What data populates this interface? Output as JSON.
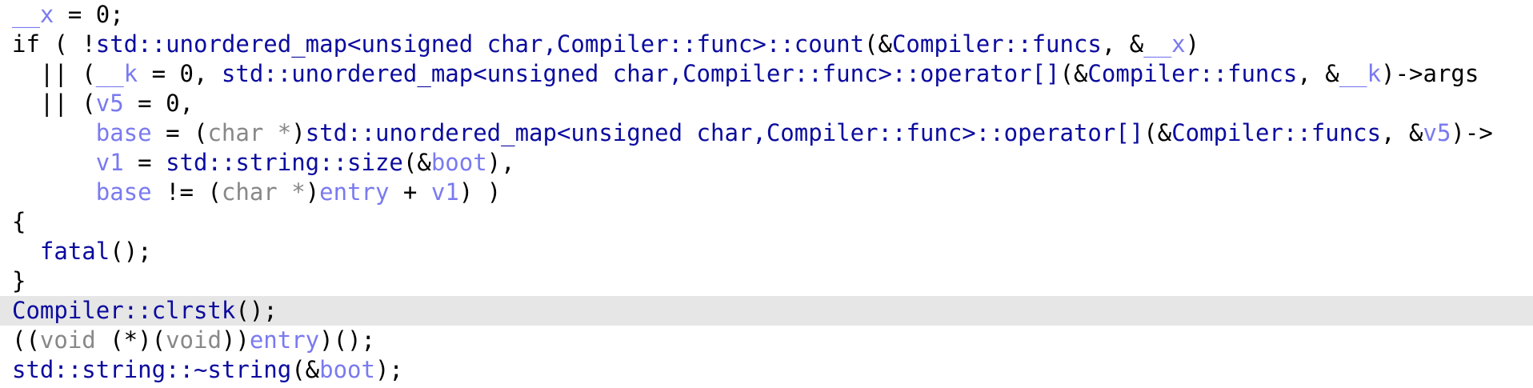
{
  "code": {
    "highlighted_line_index": 10,
    "lines": [
      [
        {
          "t": "var",
          "s": "__x"
        },
        {
          "t": "plain",
          "s": " = 0;"
        }
      ],
      [
        {
          "t": "kw",
          "s": "if"
        },
        {
          "t": "plain",
          "s": " ( !"
        },
        {
          "t": "fn",
          "s": "std::unordered_map<unsigned char,Compiler::func>::count"
        },
        {
          "t": "plain",
          "s": "(&"
        },
        {
          "t": "fn",
          "s": "Compiler::funcs"
        },
        {
          "t": "plain",
          "s": ", &"
        },
        {
          "t": "var",
          "s": "__x"
        },
        {
          "t": "plain",
          "s": ")"
        }
      ],
      [
        {
          "t": "plain",
          "s": "  || ("
        },
        {
          "t": "var",
          "s": "__k"
        },
        {
          "t": "plain",
          "s": " = 0, "
        },
        {
          "t": "fn",
          "s": "std::unordered_map<unsigned char,Compiler::func>::operator[]"
        },
        {
          "t": "plain",
          "s": "(&"
        },
        {
          "t": "fn",
          "s": "Compiler::funcs"
        },
        {
          "t": "plain",
          "s": ", &"
        },
        {
          "t": "var",
          "s": "__k"
        },
        {
          "t": "plain",
          "s": ")->args"
        }
      ],
      [
        {
          "t": "plain",
          "s": "  || ("
        },
        {
          "t": "var",
          "s": "v5"
        },
        {
          "t": "plain",
          "s": " = 0,"
        }
      ],
      [
        {
          "t": "plain",
          "s": "      "
        },
        {
          "t": "var",
          "s": "base"
        },
        {
          "t": "plain",
          "s": " = ("
        },
        {
          "t": "type",
          "s": "char *"
        },
        {
          "t": "plain",
          "s": ")"
        },
        {
          "t": "fn",
          "s": "std::unordered_map<unsigned char,Compiler::func>::operator[]"
        },
        {
          "t": "plain",
          "s": "(&"
        },
        {
          "t": "fn",
          "s": "Compiler::funcs"
        },
        {
          "t": "plain",
          "s": ", &"
        },
        {
          "t": "var",
          "s": "v5"
        },
        {
          "t": "plain",
          "s": ")->"
        }
      ],
      [
        {
          "t": "plain",
          "s": "      "
        },
        {
          "t": "var",
          "s": "v1"
        },
        {
          "t": "plain",
          "s": " = "
        },
        {
          "t": "fn",
          "s": "std::string::size"
        },
        {
          "t": "plain",
          "s": "(&"
        },
        {
          "t": "var",
          "s": "boot"
        },
        {
          "t": "plain",
          "s": "),"
        }
      ],
      [
        {
          "t": "plain",
          "s": "      "
        },
        {
          "t": "var",
          "s": "base"
        },
        {
          "t": "plain",
          "s": " != ("
        },
        {
          "t": "type",
          "s": "char *"
        },
        {
          "t": "plain",
          "s": ")"
        },
        {
          "t": "var",
          "s": "entry"
        },
        {
          "t": "plain",
          "s": " + "
        },
        {
          "t": "var",
          "s": "v1"
        },
        {
          "t": "plain",
          "s": ") )"
        }
      ],
      [
        {
          "t": "plain",
          "s": "{"
        }
      ],
      [
        {
          "t": "plain",
          "s": "  "
        },
        {
          "t": "fn",
          "s": "fatal"
        },
        {
          "t": "plain",
          "s": "();"
        }
      ],
      [
        {
          "t": "plain",
          "s": "}"
        }
      ],
      [
        {
          "t": "fn",
          "s": "Compiler::clrstk"
        },
        {
          "t": "plain",
          "s": "();"
        }
      ],
      [
        {
          "t": "plain",
          "s": "(("
        },
        {
          "t": "type",
          "s": "void"
        },
        {
          "t": "plain",
          "s": " (*)("
        },
        {
          "t": "type",
          "s": "void"
        },
        {
          "t": "plain",
          "s": "))"
        },
        {
          "t": "var",
          "s": "entry"
        },
        {
          "t": "plain",
          "s": ")();"
        }
      ],
      [
        {
          "t": "fn",
          "s": "std::string::~string"
        },
        {
          "t": "plain",
          "s": "(&"
        },
        {
          "t": "var",
          "s": "boot"
        },
        {
          "t": "plain",
          "s": ");"
        }
      ]
    ]
  }
}
